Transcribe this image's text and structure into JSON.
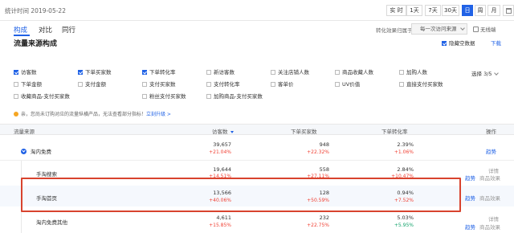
{
  "header": {
    "stat_time": "统计时间 2019-05-22",
    "ranges": [
      {
        "label": "实 时",
        "active": false
      },
      {
        "label": "1天",
        "active": false
      },
      {
        "label": "7天",
        "active": false
      },
      {
        "label": "30天",
        "active": false
      },
      {
        "label": "日",
        "active": true
      },
      {
        "label": "周",
        "active": false
      },
      {
        "label": "月",
        "active": false
      }
    ],
    "calendar_icon": "calendar-icon"
  },
  "tabs": [
    {
      "label": "构成",
      "active": true
    },
    {
      "label": "对比",
      "active": false
    },
    {
      "label": "同行",
      "active": false
    }
  ],
  "filters": {
    "conversion_label": "转化效果归属于：",
    "conversion_value": "每一次访问来源",
    "device_label": "无线端"
  },
  "section": {
    "title": "流量来源构成",
    "hide_empty": "隐藏空数据",
    "download": "下载"
  },
  "metrics": [
    {
      "label": "访客数",
      "checked": true
    },
    {
      "label": "下单买家数",
      "checked": true
    },
    {
      "label": "下单转化率",
      "checked": true
    },
    {
      "label": "新访客数",
      "checked": false
    },
    {
      "label": "关注店铺人数",
      "checked": false
    },
    {
      "label": "商品收藏人数",
      "checked": false
    },
    {
      "label": "加购人数",
      "checked": false
    },
    {
      "label": "下单金额",
      "checked": false
    },
    {
      "label": "支付金额",
      "checked": false
    },
    {
      "label": "支付买家数",
      "checked": false
    },
    {
      "label": "支付转化率",
      "checked": false
    },
    {
      "label": "客单价",
      "checked": false
    },
    {
      "label": "UV价值",
      "checked": false
    },
    {
      "label": "直接支付买家数",
      "checked": false
    },
    {
      "label": "收藏商品-支付买家数",
      "checked": false
    },
    {
      "label": "粉丝支付买家数",
      "checked": false
    },
    {
      "label": "加购商品-支付买家数",
      "checked": false
    }
  ],
  "select_count": "选择 3/5",
  "notice": {
    "text": "亲，您尚未订购对应的流量纵横产品，无法查看部分指标！",
    "link": "立刻升级 >"
  },
  "table": {
    "headers": {
      "source": "流量来源",
      "visitors": "访客数",
      "buyers": "下单买家数",
      "rate": "下单转化率",
      "ops": "操作"
    },
    "rows": [
      {
        "name": "淘内免费",
        "visitors": "39,657",
        "visitors_chg": "+21.04%",
        "buyers": "948",
        "buyers_chg": "+22.32%",
        "rate": "2.39%",
        "rate_chg": "+1.06%",
        "ops": [
          "趋势"
        ]
      },
      {
        "name": "手淘搜索",
        "visitors": "19,644",
        "visitors_chg": "+14.51%",
        "buyers": "558",
        "buyers_chg": "+27.11%",
        "rate": "2.84%",
        "rate_chg": "+10.47%",
        "ops": [
          "趋势",
          "商品效果"
        ],
        "extra_op": "详情"
      },
      {
        "name": "手淘首页",
        "visitors": "13,566",
        "visitors_chg": "+40.06%",
        "buyers": "128",
        "buyers_chg": "+50.59%",
        "rate": "0.94%",
        "rate_chg": "+7.52%",
        "ops": [
          "趋势",
          "商品效果"
        ]
      },
      {
        "name": "淘内免费其他",
        "visitors": "4,611",
        "visitors_chg": "+15.85%",
        "buyers": "232",
        "buyers_chg": "+22.75%",
        "rate": "5.03%",
        "rate_chg": "+5.95%",
        "ops": [
          "趋势",
          "商品效果"
        ],
        "extra_op": "详情"
      }
    ]
  },
  "colors": {
    "accent": "#2062e6",
    "up_red": "#f04134",
    "up_green": "#12a36b",
    "highlight_box": "#d8432e"
  }
}
